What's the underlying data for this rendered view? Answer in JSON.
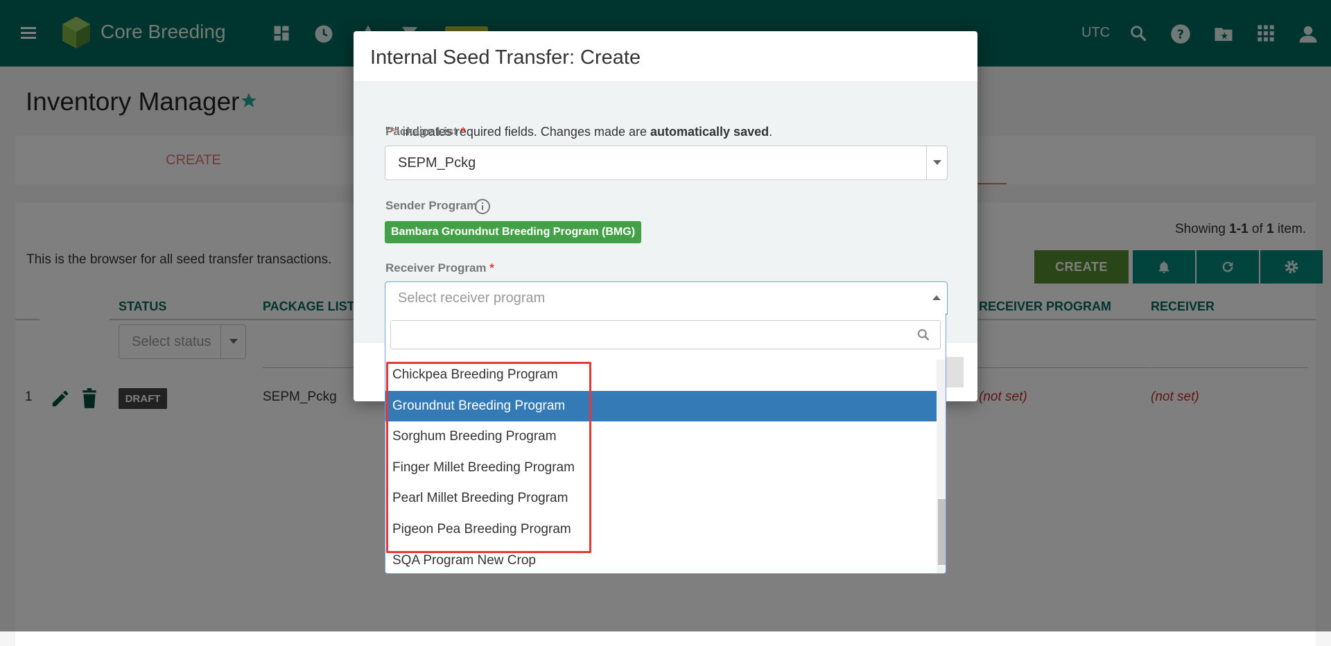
{
  "app": {
    "brand": "Core Breeding",
    "timezone": "UTC",
    "colors": {
      "primary": "#00695c",
      "accent_green": "#558b2f",
      "teal": "#00897b",
      "highlight": "#337ab7",
      "error": "#e53935"
    }
  },
  "page": {
    "title": "Inventory Manager",
    "tab_create": "CREATE",
    "description": "This is the browser for all seed transfer transactions.",
    "showing_prefix": "Showing ",
    "showing_range": "1-1",
    "showing_mid": " of ",
    "showing_total": "1",
    "showing_suffix": " item.",
    "create_button": "CREATE",
    "columns": {
      "status": "STATUS",
      "package_list": "PACKAGE LIST",
      "receiver_program": "RECEIVER PROGRAM",
      "receiver": "RECEIVER"
    },
    "status_filter_placeholder": "Select status",
    "row": {
      "number": "1",
      "status": "DRAFT",
      "package_list": "SEPM_Pckg",
      "receiver_program": "(not set)",
      "receiver": "(not set)"
    }
  },
  "modal": {
    "title": "Internal Seed Transfer: Create",
    "note_q1": "\"",
    "note_star": "*",
    "note_q2": "\" indicates required fields. Changes made are ",
    "note_bold": "automatically saved",
    "note_end": ".",
    "package_list_label": "Package List",
    "package_list_value": "SEPM_Pckg",
    "sender_label": "Sender Program",
    "sender_value": "Bambara Groundnut Breeding Program (BMG)",
    "receiver_label": "Receiver Program",
    "receiver_placeholder": "Select receiver program",
    "required_mark": "*"
  },
  "dropdown": {
    "search_value": "",
    "options": [
      {
        "label": "Chickpea Breeding Program",
        "active": false
      },
      {
        "label": "Groundnut Breeding Program",
        "active": true
      },
      {
        "label": "Sorghum Breeding Program",
        "active": false
      },
      {
        "label": "Finger Millet Breeding Program",
        "active": false
      },
      {
        "label": "Pearl Millet Breeding Program",
        "active": false
      },
      {
        "label": "Pigeon Pea Breeding Program",
        "active": false
      },
      {
        "label": "SQA Program New Crop",
        "active": false
      }
    ]
  }
}
